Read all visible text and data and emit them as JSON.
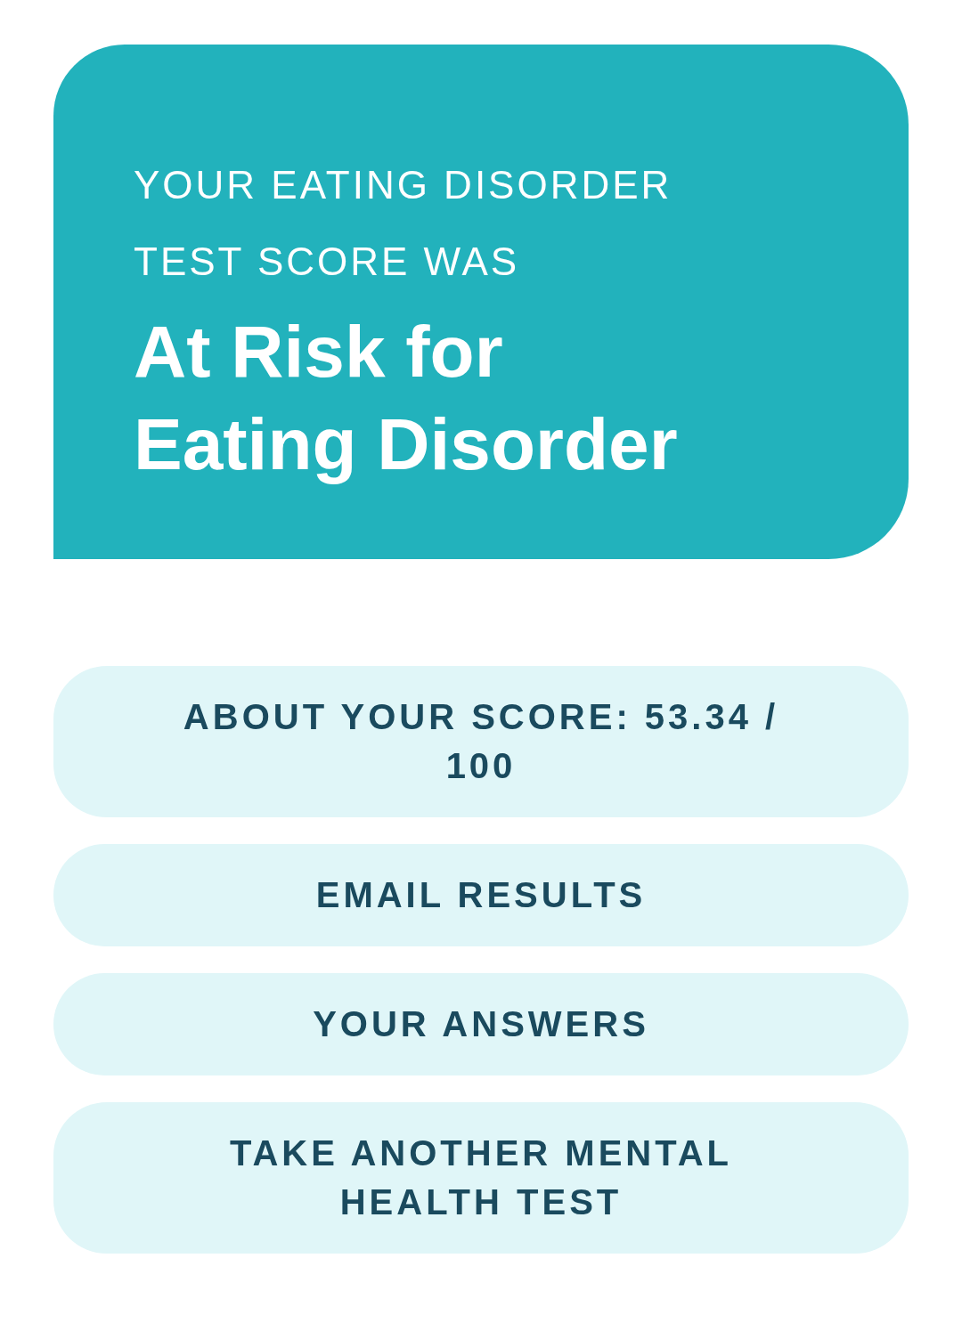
{
  "result": {
    "subtitle": "YOUR EATING DISORDER TEST SCORE WAS",
    "title_lines": [
      "At Risk for",
      "Eating Disorder"
    ]
  },
  "buttons": [
    {
      "label": "ABOUT YOUR SCORE: 53.34 / 100"
    },
    {
      "label": "EMAIL RESULTS"
    },
    {
      "label": "YOUR ANSWERS"
    },
    {
      "label": "TAKE ANOTHER MENTAL HEALTH TEST"
    }
  ]
}
